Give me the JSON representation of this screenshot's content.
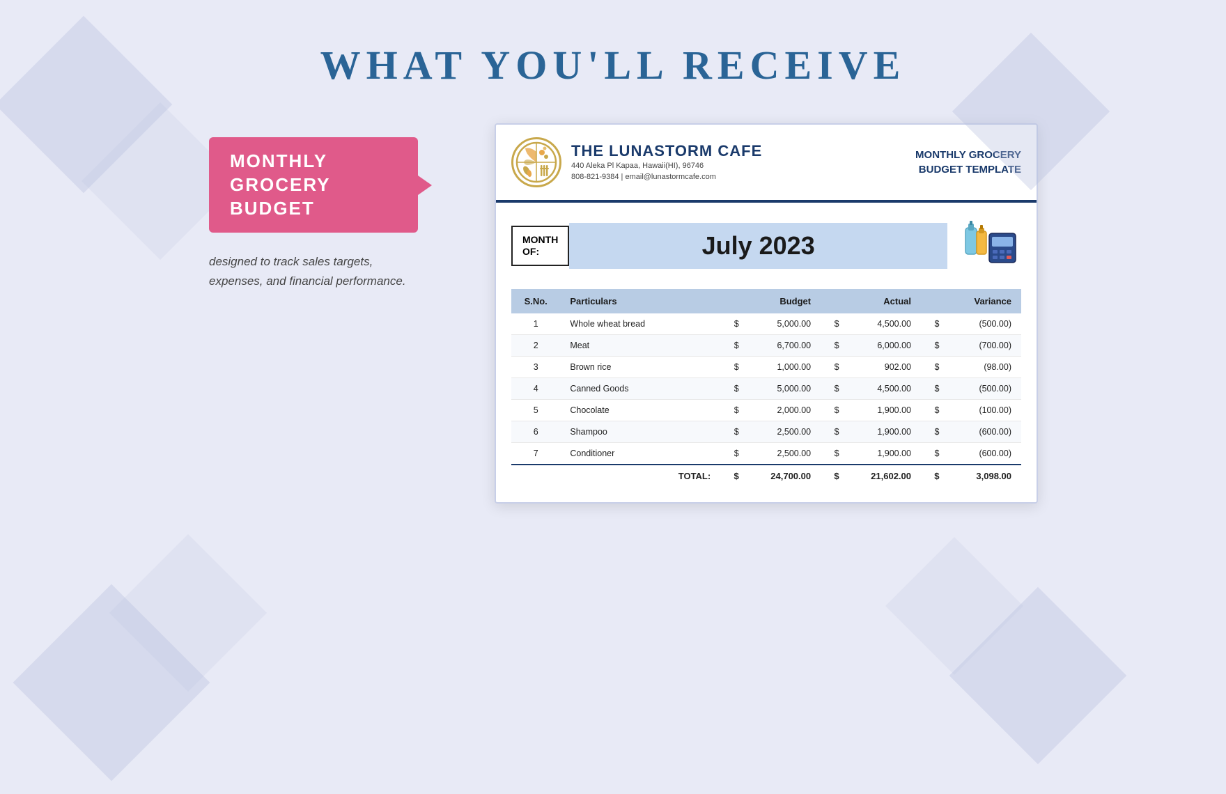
{
  "page": {
    "title": "WHAT YOU'LL RECEIVE",
    "background_color": "#e8eaf6"
  },
  "badge": {
    "label": "MONTHLY GROCERY\nBUDGET"
  },
  "subtitle": {
    "text": "designed to track sales targets,\nexpenses, and financial performance."
  },
  "document": {
    "cafe": {
      "name": "THE LUNASTORM CAFE",
      "address": "440 Aleka Pl Kapaa, Hawaii(HI), 96746",
      "contact": "808-821-9384 | email@lunastormcafe.com"
    },
    "template_title_line1": "MONTHLY GROCERY",
    "template_title_line2": "BUDGET TEMPLATE",
    "month_label": "MONTH\nOF:",
    "month_value": "July 2023",
    "table": {
      "headers": [
        "S.No.",
        "Particulars",
        "",
        "Budget",
        "",
        "Actual",
        "",
        "Variance"
      ],
      "rows": [
        {
          "sno": "1",
          "particulars": "Whole wheat bread",
          "budget_sym": "$",
          "budget": "5,000.00",
          "actual_sym": "$",
          "actual": "4,500.00",
          "variance_sym": "$",
          "variance": "(500.00)"
        },
        {
          "sno": "2",
          "particulars": "Meat",
          "budget_sym": "$",
          "budget": "6,700.00",
          "actual_sym": "$",
          "actual": "6,000.00",
          "variance_sym": "$",
          "variance": "(700.00)"
        },
        {
          "sno": "3",
          "particulars": "Brown rice",
          "budget_sym": "$",
          "budget": "1,000.00",
          "actual_sym": "$",
          "actual": "902.00",
          "variance_sym": "$",
          "variance": "(98.00)"
        },
        {
          "sno": "4",
          "particulars": "Canned Goods",
          "budget_sym": "$",
          "budget": "5,000.00",
          "actual_sym": "$",
          "actual": "4,500.00",
          "variance_sym": "$",
          "variance": "(500.00)"
        },
        {
          "sno": "5",
          "particulars": "Chocolate",
          "budget_sym": "$",
          "budget": "2,000.00",
          "actual_sym": "$",
          "actual": "1,900.00",
          "variance_sym": "$",
          "variance": "(100.00)"
        },
        {
          "sno": "6",
          "particulars": "Shampoo",
          "budget_sym": "$",
          "budget": "2,500.00",
          "actual_sym": "$",
          "actual": "1,900.00",
          "variance_sym": "$",
          "variance": "(600.00)"
        },
        {
          "sno": "7",
          "particulars": "Conditioner",
          "budget_sym": "$",
          "budget": "2,500.00",
          "actual_sym": "$",
          "actual": "1,900.00",
          "variance_sym": "$",
          "variance": "(600.00)"
        }
      ],
      "total": {
        "label": "TOTAL:",
        "budget_sym": "$",
        "budget": "24,700.00",
        "actual_sym": "$",
        "actual": "21,602.00",
        "variance_sym": "$",
        "variance": "3,098.00"
      }
    }
  }
}
